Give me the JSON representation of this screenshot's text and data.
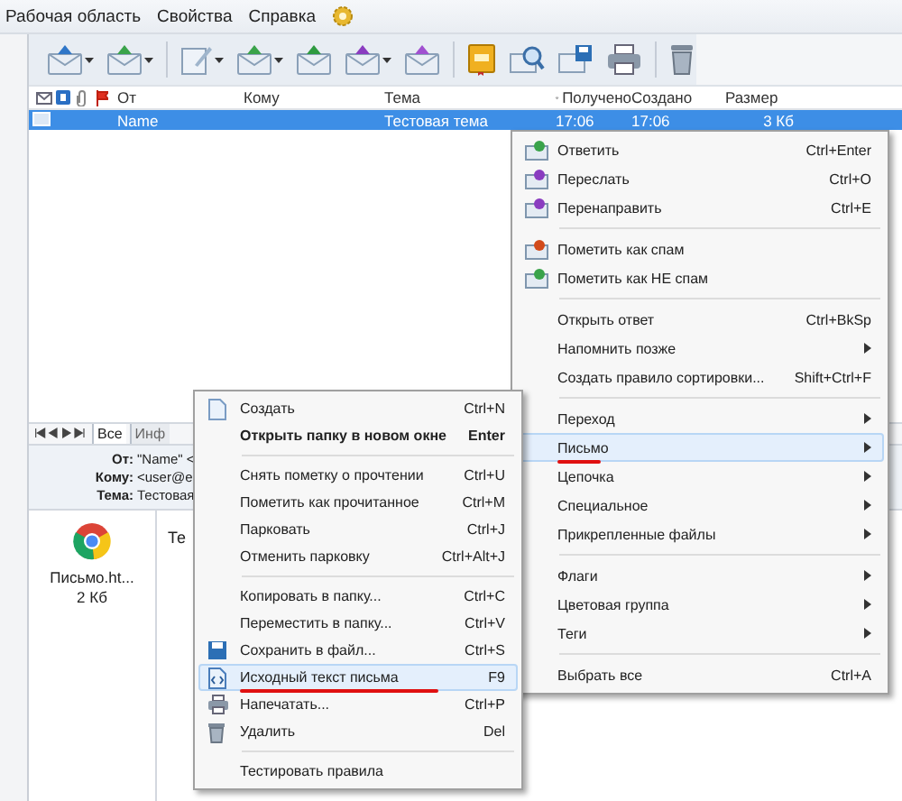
{
  "menubar": {
    "items": [
      "Рабочая область",
      "Свойства",
      "Справка"
    ]
  },
  "message_list": {
    "columns": [
      {
        "label": "От",
        "sorted": false
      },
      {
        "label": "Кому",
        "sorted": false
      },
      {
        "label": "Тема",
        "sorted": false
      },
      {
        "label": "Получено",
        "sorted": true
      },
      {
        "label": "Создано",
        "sorted": false
      },
      {
        "label": "Размер",
        "sorted": false
      }
    ],
    "rows": [
      {
        "from": "Name",
        "subject": "Тестовая тема",
        "received": "17:06",
        "created": "17:06",
        "size": "3 Кб",
        "selected": true
      }
    ]
  },
  "preview": {
    "tabs": [
      {
        "label": "Все",
        "selected": true
      },
      {
        "label": "Инф",
        "selected": false
      }
    ],
    "fields": [
      {
        "label": "От:",
        "value": "\"Name\" <"
      },
      {
        "label": "Кому:",
        "value": "<user@e"
      },
      {
        "label": "Тема:",
        "value": "Тестовая"
      }
    ],
    "attachment": {
      "name": "Письмо.ht...",
      "size": "2 Кб"
    },
    "body": "Те"
  },
  "context_menu": {
    "groups": [
      [
        {
          "label": "Ответить",
          "shortcut": "Ctrl+Enter",
          "submenu": false,
          "selected": false,
          "underlined": false
        },
        {
          "label": "Переслать",
          "shortcut": "Ctrl+O",
          "submenu": false,
          "selected": false,
          "underlined": false
        },
        {
          "label": "Перенаправить",
          "shortcut": "Ctrl+E",
          "submenu": false,
          "selected": false,
          "underlined": false
        }
      ],
      [
        {
          "label": "Пометить как спам",
          "submenu": false,
          "selected": false,
          "underlined": false
        },
        {
          "label": "Пометить как НЕ спам",
          "submenu": false,
          "selected": false,
          "underlined": false
        }
      ],
      [
        {
          "label": "Открыть ответ",
          "shortcut": "Ctrl+BkSp",
          "submenu": false,
          "selected": false,
          "underlined": false
        },
        {
          "label": "Напомнить позже",
          "submenu": true,
          "selected": false,
          "underlined": false
        },
        {
          "label": "Создать правило сортировки...",
          "shortcut": "Shift+Ctrl+F",
          "submenu": false,
          "selected": false,
          "underlined": false
        }
      ],
      [
        {
          "label": "Переход",
          "submenu": true,
          "selected": false,
          "underlined": false
        },
        {
          "label": "Письмо",
          "submenu": true,
          "selected": true,
          "underlined": true
        },
        {
          "label": "Цепочка",
          "submenu": true,
          "selected": false,
          "underlined": false
        },
        {
          "label": "Специальное",
          "submenu": true,
          "selected": false,
          "underlined": false
        },
        {
          "label": "Прикрепленные файлы",
          "submenu": true,
          "selected": false,
          "underlined": false
        }
      ],
      [
        {
          "label": "Флаги",
          "submenu": true,
          "selected": false,
          "underlined": false
        },
        {
          "label": "Цветовая группа",
          "submenu": true,
          "selected": false,
          "underlined": false
        },
        {
          "label": "Теги",
          "submenu": true,
          "selected": false,
          "underlined": false
        }
      ],
      [
        {
          "label": "Выбрать все",
          "shortcut": "Ctrl+A",
          "submenu": false,
          "selected": false,
          "underlined": false
        }
      ]
    ]
  },
  "submenu": {
    "groups": [
      [
        {
          "label": "Создать",
          "shortcut": "Ctrl+N",
          "bold": false,
          "selected": false,
          "underlined": false
        },
        {
          "label": "Открыть папку в новом окне",
          "shortcut": "Enter",
          "bold": true,
          "selected": false,
          "underlined": false
        }
      ],
      [
        {
          "label": "Снять пометку о прочтении",
          "shortcut": "Ctrl+U",
          "bold": false,
          "selected": false,
          "underlined": false
        },
        {
          "label": "Пометить как прочитанное",
          "shortcut": "Ctrl+M",
          "bold": false,
          "selected": false,
          "underlined": false
        },
        {
          "label": "Парковать",
          "shortcut": "Ctrl+J",
          "bold": false,
          "selected": false,
          "underlined": false
        },
        {
          "label": "Отменить парковку",
          "shortcut": "Ctrl+Alt+J",
          "bold": false,
          "selected": false,
          "underlined": false
        }
      ],
      [
        {
          "label": "Копировать в папку...",
          "shortcut": "Ctrl+C",
          "bold": false,
          "selected": false,
          "underlined": false
        },
        {
          "label": "Переместить в папку...",
          "shortcut": "Ctrl+V",
          "bold": false,
          "selected": false,
          "underlined": false
        },
        {
          "label": "Сохранить в файл...",
          "shortcut": "Ctrl+S",
          "bold": false,
          "selected": false,
          "underlined": false
        },
        {
          "label": "Исходный текст письма",
          "shortcut": "F9",
          "bold": false,
          "selected": true,
          "underlined": true
        },
        {
          "label": "Напечатать...",
          "shortcut": "Ctrl+P",
          "bold": false,
          "selected": false,
          "underlined": false
        },
        {
          "label": "Удалить",
          "shortcut": "Del",
          "bold": false,
          "selected": false,
          "underlined": false
        }
      ],
      [
        {
          "label": "Тестировать правила",
          "bold": false,
          "selected": false,
          "underlined": false
        }
      ]
    ]
  }
}
